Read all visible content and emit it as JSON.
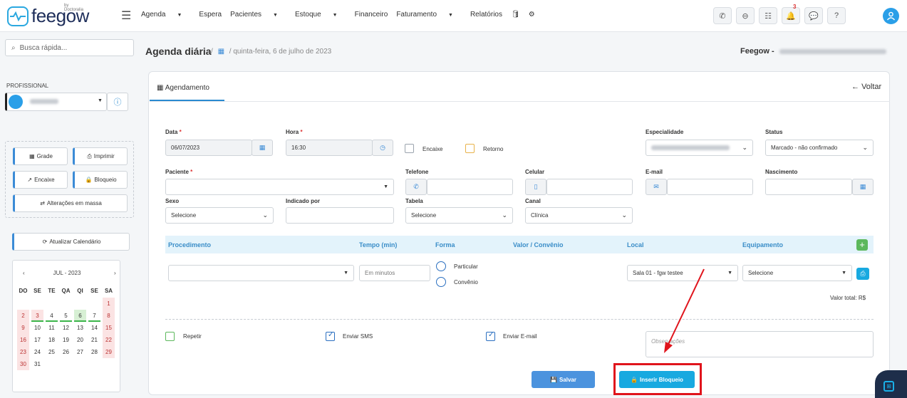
{
  "topbar": {
    "logo_by": "by Doctoralia",
    "logo_text": "feegow",
    "nav": [
      {
        "label": "Agenda",
        "dropdown": true
      },
      {
        "label": "Espera",
        "dropdown": false
      },
      {
        "label": "Pacientes",
        "dropdown": true
      },
      {
        "label": "Estoque",
        "dropdown": true
      },
      {
        "label": "Financeiro",
        "dropdown": false
      },
      {
        "label": "Faturamento",
        "dropdown": true
      },
      {
        "label": "Relatórios",
        "dropdown": false
      }
    ],
    "notification_count": "3"
  },
  "sidebar": {
    "search_placeholder": "Busca rápida...",
    "profissional_label": "PROFISSIONAL",
    "buttons": {
      "grade": "Grade",
      "imprimir": "Imprimir",
      "encaixe": "Encaixe",
      "bloqueio": "Bloqueio",
      "alteracoes": "Alterações em massa",
      "atualizar": "Atualizar Calendário"
    },
    "calendar": {
      "month": "JUL - 2023",
      "weekdays": [
        "DO",
        "SE",
        "TE",
        "QA",
        "QI",
        "SE",
        "SA"
      ],
      "weeks": [
        [
          "",
          "",
          "",
          "",
          "",
          "",
          "1"
        ],
        [
          "2",
          "3",
          "4",
          "5",
          "6",
          "7",
          "8"
        ],
        [
          "9",
          "10",
          "11",
          "12",
          "13",
          "14",
          "15"
        ],
        [
          "16",
          "17",
          "18",
          "19",
          "20",
          "21",
          "22"
        ],
        [
          "23",
          "24",
          "25",
          "26",
          "27",
          "28",
          "29"
        ],
        [
          "30",
          "31",
          "",
          "",
          "",
          "",
          ""
        ]
      ],
      "selected_day": "6"
    }
  },
  "header": {
    "title": "Agenda diária",
    "separator": "/",
    "date": "quinta-feira, 6 de julho de 2023",
    "clinic_prefix": "Feegow -"
  },
  "form": {
    "tab": "Agendamento",
    "back": "Voltar",
    "data_label": "Data",
    "data_value": "06/07/2023",
    "hora_label": "Hora",
    "hora_value": "16:30",
    "encaixe": "Encaixe",
    "retorno": "Retorno",
    "especialidade_label": "Especialidade",
    "status_label": "Status",
    "status_value": "Marcado - não confirmado",
    "paciente_label": "Paciente",
    "telefone_label": "Telefone",
    "celular_label": "Celular",
    "email_label": "E-mail",
    "nascimento_label": "Nascimento",
    "sexo_label": "Sexo",
    "sexo_value": "Selecione",
    "indicado_label": "Indicado por",
    "tabela_label": "Tabela",
    "tabela_value": "Selecione",
    "canal_label": "Canal",
    "canal_value": "Clínica",
    "proc_headers": {
      "procedimento": "Procedimento",
      "tempo": "Tempo (min)",
      "forma": "Forma",
      "valor": "Valor / Convênio",
      "local": "Local",
      "equipamento": "Equipamento"
    },
    "tempo_placeholder": "Em minutos",
    "forma_particular": "Particular",
    "forma_convenio": "Convênio",
    "local_value": "Sala 01 - fgw testee",
    "equipamento_value": "Selecione",
    "valor_total": "Valor total: R$",
    "repetir": "Repetir",
    "enviar_sms": "Enviar SMS",
    "enviar_email": "Enviar E-mail",
    "observacoes_placeholder": "Observações",
    "salvar": "Salvar",
    "inserir_bloqueio": "Inserir Bloqueio"
  },
  "colors": {
    "accent": "#2a8ad0",
    "salvar_btn": "#4b93de",
    "bloqueio_btn": "#18a9e0",
    "highlight": "#e0141c"
  }
}
